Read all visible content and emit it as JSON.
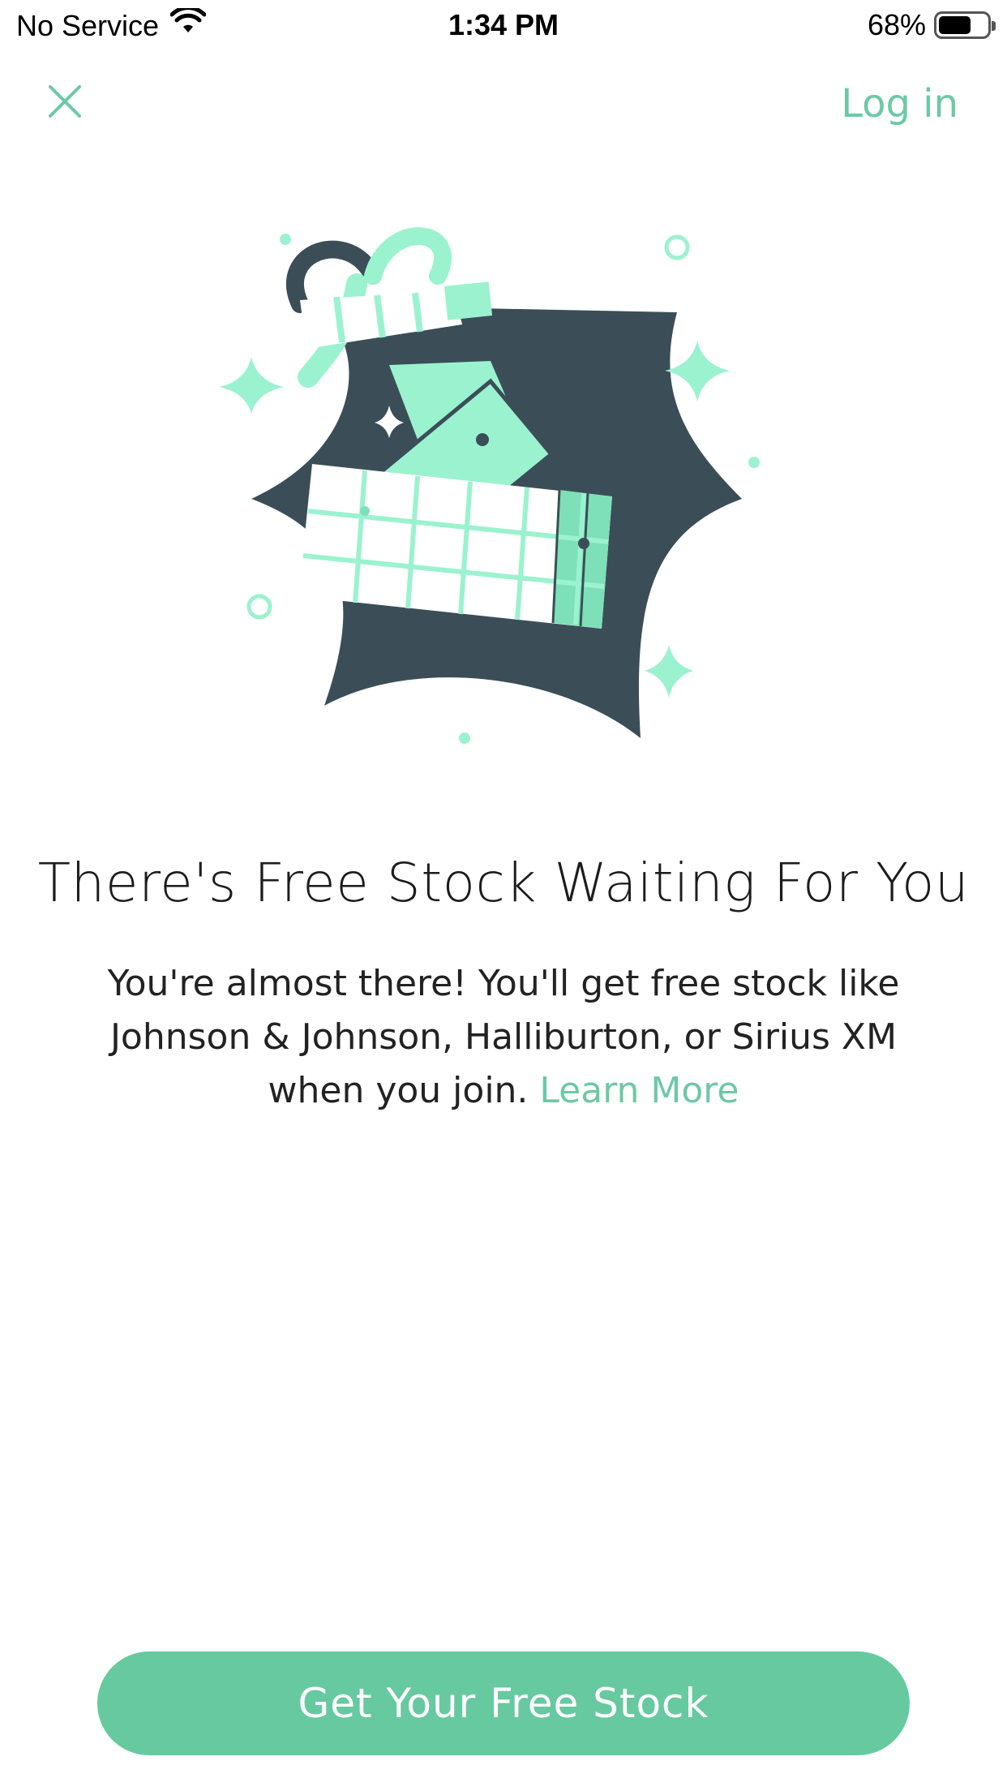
{
  "status_bar": {
    "carrier": "No Service",
    "time": "1:34 PM",
    "battery": "68%",
    "battery_level": 0.68
  },
  "nav": {
    "close_icon": "close-icon",
    "login_label": "Log in"
  },
  "content": {
    "title": "There's Free Stock Waiting For You",
    "description": "You're almost there! You'll get free stock like Johnson & Johnson, Halliburton, or Sirius XM when you join.",
    "learn_more": "Learn More"
  },
  "cta": {
    "label": "Get Your Free Stock"
  },
  "colors": {
    "accent": "#6cc9a5",
    "button": "#67c9a0",
    "dark": "#3b4e58",
    "mint": "#9bf2cf"
  }
}
